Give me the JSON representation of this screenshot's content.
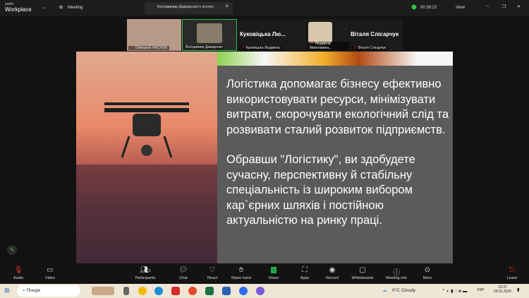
{
  "app": {
    "brand_small": "zoom",
    "brand": "Workplace",
    "meeting_label": "Meeting",
    "share_tab": "Володимир Давиденко's screen",
    "timer": "00:38:22",
    "view_label": "View"
  },
  "participants": [
    {
      "name": "Oleksandr FAICHUK"
    },
    {
      "name": "Володимир Давиденко"
    },
    {
      "name": "Куковіцька Людмила",
      "big": "Куковіцька Лю..."
    },
    {
      "name": "Людмила Миколаївна..."
    },
    {
      "name": "Віталя Слісарчук",
      "big": "Віталя Слісарчук"
    }
  ],
  "slide": {
    "paragraphs": [
      "Логістика допомагає бізнесу ефективно використовувати ресурси, мінімізувати витрати, скорочувати екологічний слід та розвивати сталий розвиток підприємств.",
      "Обравши \"Логістику\", ви здобудете сучасну, перспективну й стабільну спеціальність із широким вибором кар`єрних шляхів і постійною актуальністю на ринку праці."
    ]
  },
  "toolbar": {
    "audio": "Audio",
    "video": "Video",
    "participants": "Participants",
    "participants_count": "5",
    "chat": "Chat",
    "react": "React",
    "raise_hand": "Raise hand",
    "share": "Share",
    "apps": "Apps",
    "record": "Record",
    "whiteboards": "Whiteboards",
    "meeting_info": "Meeting info",
    "more": "More",
    "leave": "Leave"
  },
  "taskbar": {
    "search_placeholder": "Пошук",
    "weather": "0°C  Cloudy",
    "lang": "УКР",
    "time": "19:37",
    "date": "29.01.2026"
  },
  "colors": {
    "accent_green": "#2fbf4a",
    "share_green": "#1fb24a",
    "leave_red": "#e33"
  }
}
